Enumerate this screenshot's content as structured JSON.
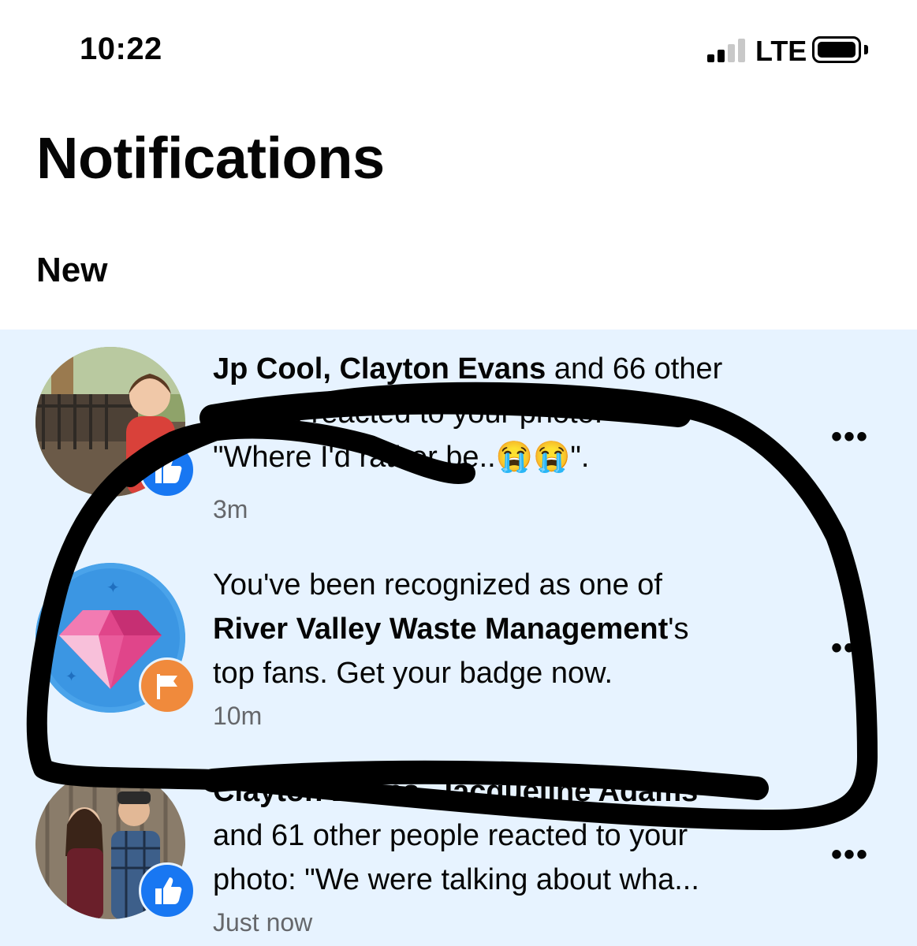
{
  "status_bar": {
    "time": "10:22",
    "network": "LTE",
    "signal_bars": 2,
    "battery_icon": "battery-icon"
  },
  "header": {
    "title": "Notifications",
    "section": "New"
  },
  "notifications": [
    {
      "bold_1": "Jp Cool, Clayton Evans",
      "text_1": " and 66 other",
      "line_2": "people reacted to your photo:",
      "line_3_a": "\"Where I'd rather be..",
      "line_3_emoji": "😭😭",
      "line_3_b": "\".",
      "time": "3m",
      "badge_icon": "like-icon",
      "more_label": "•••"
    },
    {
      "text_1": "You've been recognized as one of",
      "bold_2": "River Valley Waste Management",
      "text_2": "'s",
      "line_3": "top fans. Get your badge now.",
      "time": "10m",
      "badge_icon": "flag-icon",
      "avatar_icon": "diamond-icon",
      "more_label": "•••"
    },
    {
      "bold_1": "Clayton Evans, Jacqueline Adams",
      "line_2": "and 61 other people reacted to your",
      "line_3": "photo: \"We were talking about wha...",
      "time": "Just now",
      "badge_icon": "like-icon",
      "more_label": "•••"
    }
  ],
  "colors": {
    "unread_bg": "#e7f3ff",
    "like_blue": "#1877f2",
    "flag_orange": "#f08a3c",
    "muted_text": "#65676b"
  }
}
